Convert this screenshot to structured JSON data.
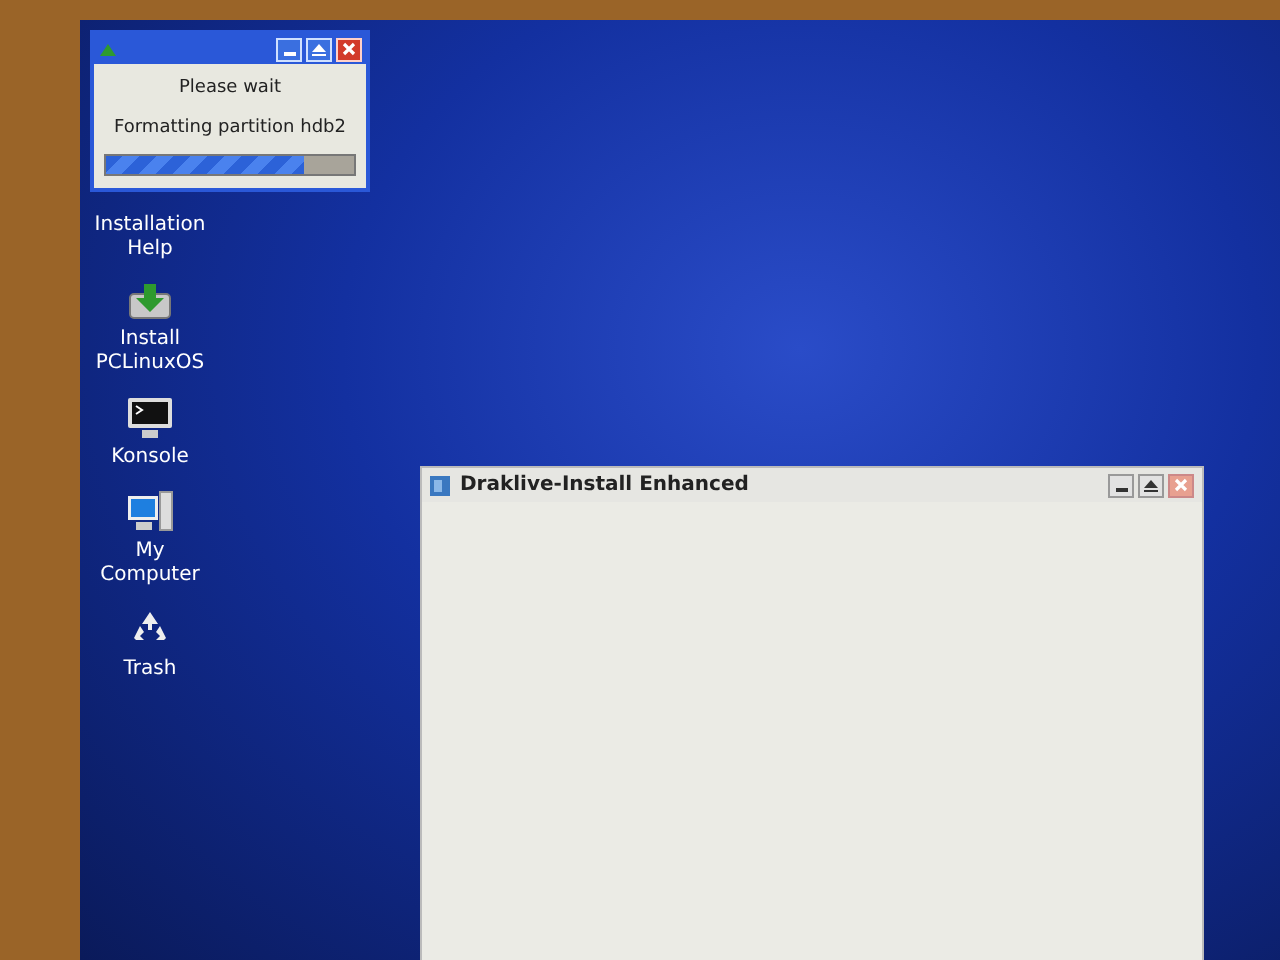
{
  "desktop_icons": [
    {
      "kind": "covered",
      "label": "Installation\nHelp"
    },
    {
      "kind": "install",
      "label": "Install\nPCLinuxOS"
    },
    {
      "kind": "terminal",
      "label": "Konsole"
    },
    {
      "kind": "computer",
      "label": "My\nComputer"
    },
    {
      "kind": "trash",
      "label": "Trash"
    }
  ],
  "progress_dialog": {
    "active": true,
    "title_line": "Please wait",
    "message": "Formatting partition hdb2",
    "level": 0.8
  },
  "main_window": {
    "active": false,
    "title": "Draklive-Install Enhanced"
  }
}
